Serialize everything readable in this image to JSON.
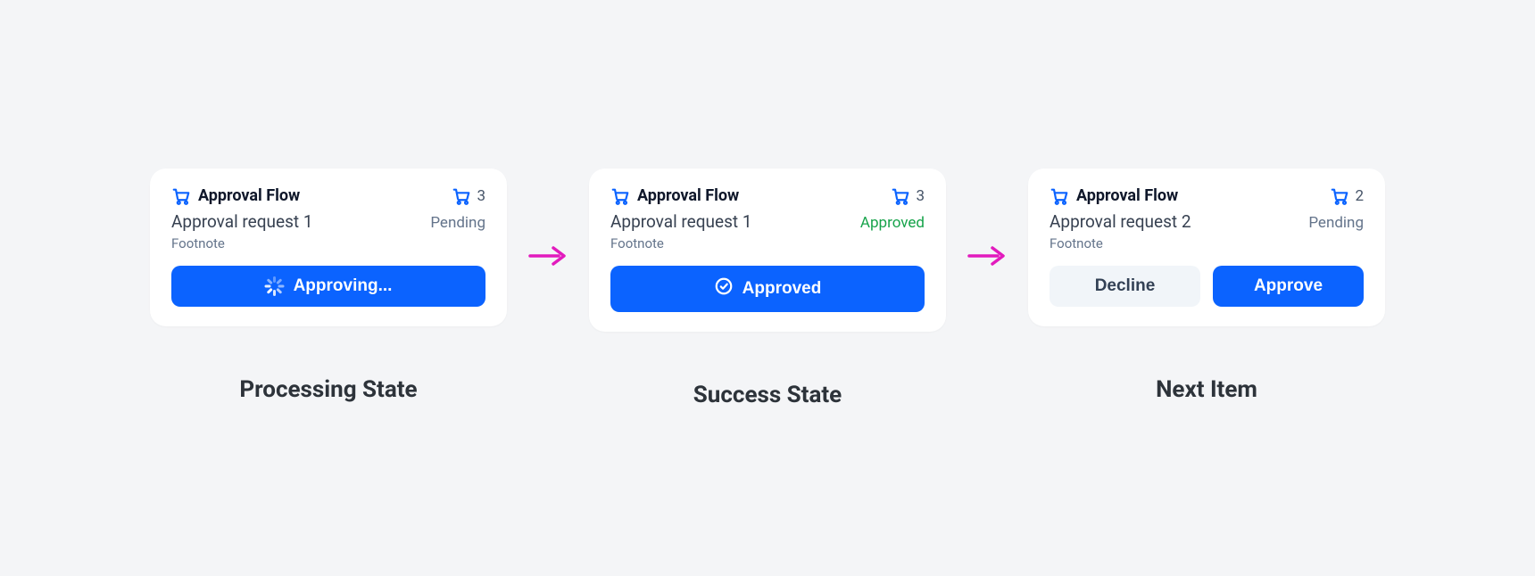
{
  "colors": {
    "primary": "#0b63ff",
    "arrow": "#e21bbd",
    "success": "#16a34a"
  },
  "cards": [
    {
      "title": "Approval Flow",
      "count": "3",
      "request": "Approval request 1",
      "status": "Pending",
      "status_kind": "pending",
      "footnote": "Footnote",
      "primary_label": "Approving...",
      "caption": "Processing State"
    },
    {
      "title": "Approval Flow",
      "count": "3",
      "request": "Approval request 1",
      "status": "Approved",
      "status_kind": "approved",
      "footnote": "Footnote",
      "primary_label": "Approved",
      "caption": "Success State"
    },
    {
      "title": "Approval Flow",
      "count": "2",
      "request": "Approval request 2",
      "status": "Pending",
      "status_kind": "pending",
      "footnote": "Footnote",
      "decline_label": "Decline",
      "approve_label": "Approve",
      "caption": "Next Item"
    }
  ]
}
